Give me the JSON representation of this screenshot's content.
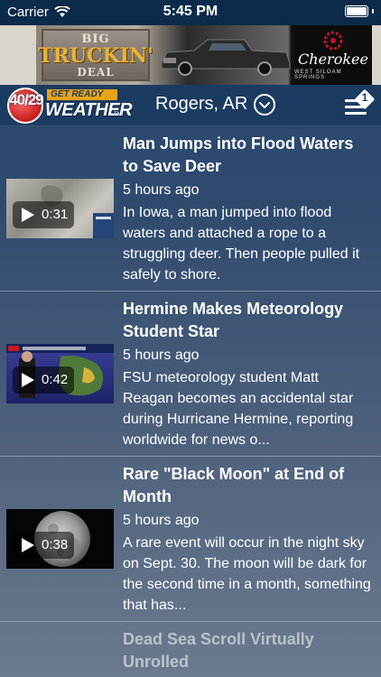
{
  "status_bar": {
    "carrier": "Carrier",
    "time": "5:45 PM"
  },
  "ad": {
    "line1": "BIG",
    "line2": "TRUCKIN'",
    "line3": "DEAL",
    "sponsor": "Cherokee",
    "sponsor_sub": "WEST SILOAM SPRINGS"
  },
  "nav": {
    "brand_number": "40/29",
    "brand_tagline": "GET READY",
    "brand_word": "WEATHER",
    "brand_tm": "TM",
    "location": "Rogers, AR",
    "menu_badge": "1"
  },
  "stories": [
    {
      "title": "Man Jumps into Flood Waters to Save Deer",
      "time": "5 hours ago",
      "description": "In Iowa, a man jumped into flood waters and attached a rope to a struggling deer. Then people pulled it safely to shore.",
      "duration": "0:31"
    },
    {
      "title": "Hermine Makes Meteorology Student Star",
      "time": "5 hours ago",
      "description": "FSU meteorology student Matt Reagan becomes an accidental star during Hurricane Hermine, reporting worldwide for news o...",
      "duration": "0:42"
    },
    {
      "title": "Rare \"Black Moon\" at End of Month",
      "time": "5 hours ago",
      "description": "A rare event will occur in the night sky on Sept. 30. The moon will be dark for the second time in a month, something that has...",
      "duration": "0:38"
    },
    {
      "title": "Dead Sea Scroll Virtually Unrolled"
    }
  ],
  "colors": {
    "nav_bg": "#1c3b61",
    "status_bg": "#0c2a4a",
    "brand_red": "#c41b1b",
    "brand_gold": "#e6a417"
  }
}
